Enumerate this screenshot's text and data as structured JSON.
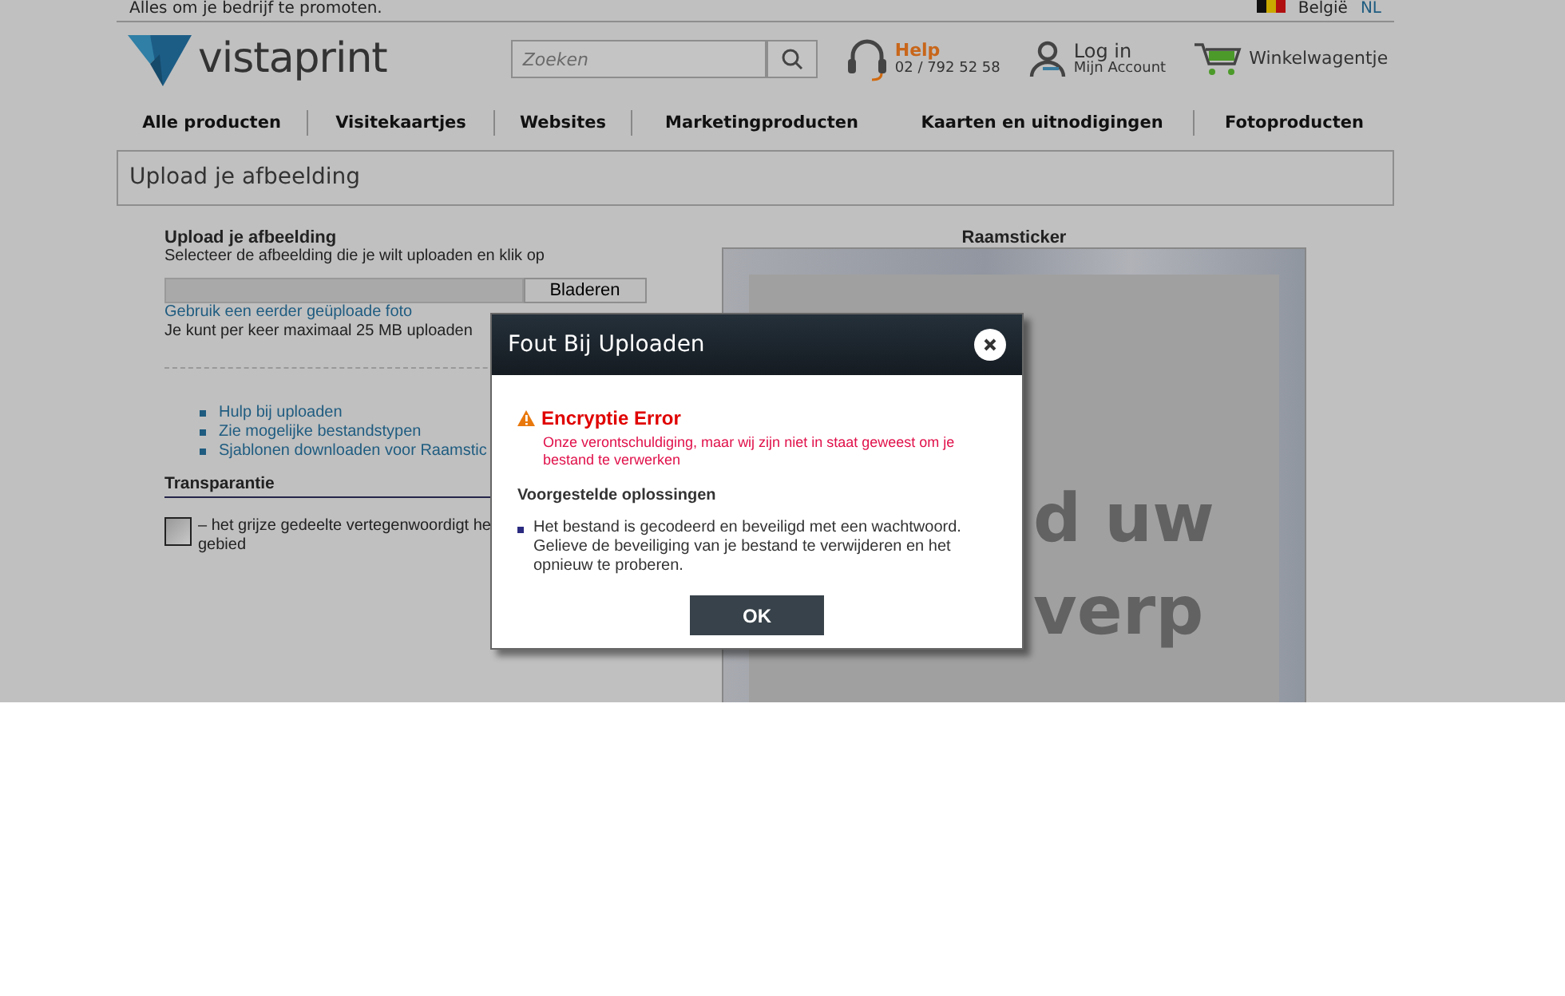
{
  "top_bar": {
    "tagline": "Alles om je bedrijf te promoten.",
    "country": "België",
    "language": "NL"
  },
  "header": {
    "logo_text": "vistaprint",
    "search": {
      "placeholder": "Zoeken"
    },
    "help": {
      "label": "Help",
      "phone": "02 / 792 52 58"
    },
    "login": {
      "label": "Log in",
      "sublabel": "Mijn Account"
    },
    "cart": {
      "label": "Winkelwagentje"
    }
  },
  "nav": [
    {
      "label": "Alle producten",
      "divider_after": true
    },
    {
      "label": "Visitekaartjes",
      "divider_after": true
    },
    {
      "label": "Websites",
      "divider_after": true
    },
    {
      "label": "Marketingproducten",
      "divider_after": false
    },
    {
      "label": "Kaarten en uitnodigingen",
      "divider_after": true
    },
    {
      "label": "Fotoproducten",
      "divider_after": false
    }
  ],
  "page_title": "Upload je afbeelding",
  "upload_panel": {
    "heading": "Upload je afbeelding",
    "instruction": "Selecteer de afbeelding die je wilt uploaden en klik op",
    "browse_button": "Bladeren",
    "previous_link": "Gebruik een eerder geüploade foto",
    "size_note": "Je kunt per keer maximaal 25 MB uploaden",
    "help_links": [
      "Hulp bij uploaden",
      "Zie mogelijke bestandstypen",
      "Sjablonen downloaden voor Raamstic"
    ],
    "transparency": {
      "heading": "Transparantie",
      "note_lines": [
        "– het grijze gedeelte vertegenwoordigt he",
        "gebied"
      ]
    }
  },
  "preview": {
    "title": "Raamsticker",
    "text_lines": [
      "d uw",
      "verp"
    ]
  },
  "dialog": {
    "title": "Fout Bij Uploaden",
    "error_title": "Encryptie Error",
    "error_message": "Onze verontschuldiging, maar wij zijn niet in staat geweest om je bestand te verwerken",
    "suggestions_heading": "Voorgestelde oplossingen",
    "suggestions": [
      "Het bestand is gecodeerd en beveiligd met een wachtwoord. Gelieve de beveiliging van je bestand te verwijderen en het opnieuw te proberen."
    ],
    "ok_button": "OK"
  }
}
